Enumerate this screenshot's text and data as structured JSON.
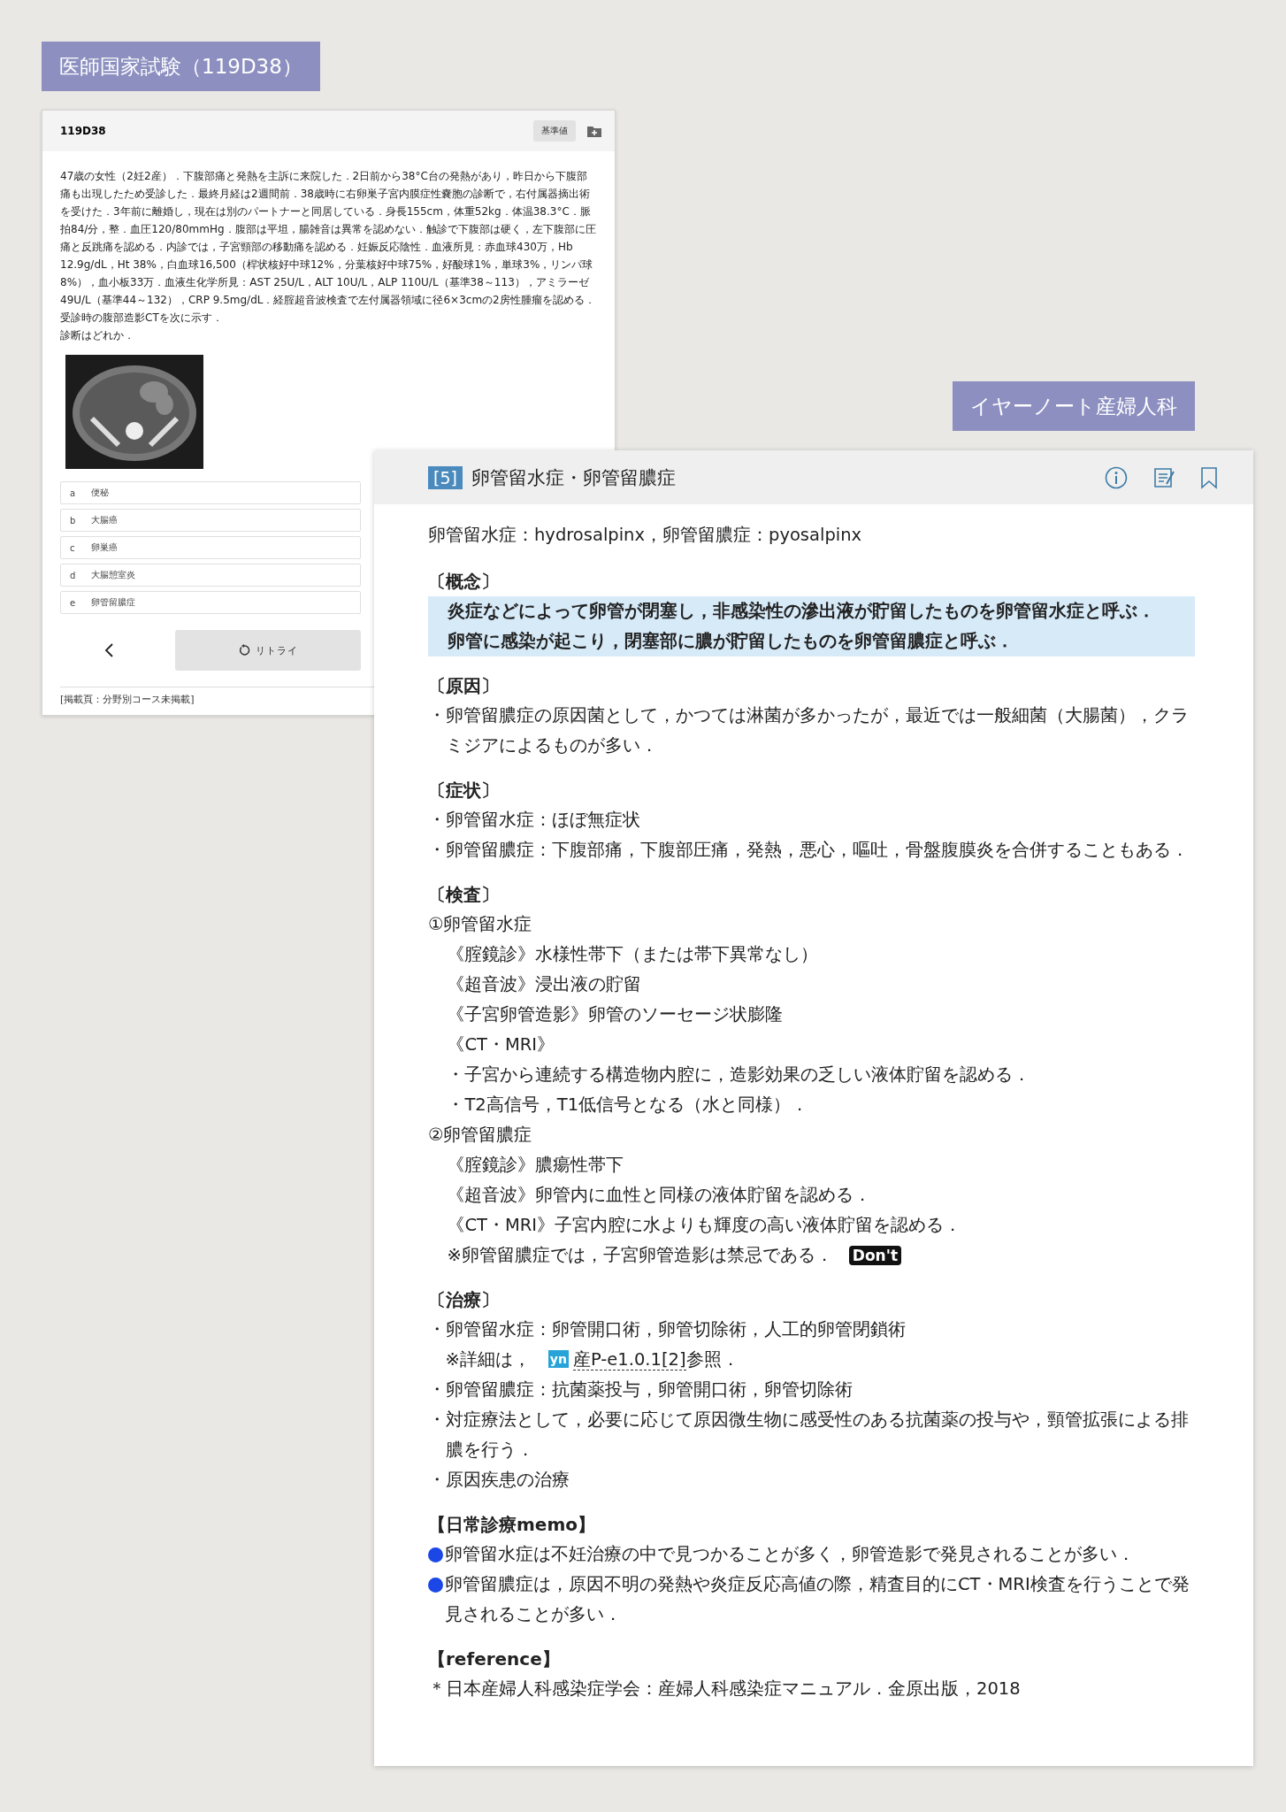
{
  "labels": [
    {
      "text": "医師国家試験（119D38）"
    },
    {
      "text": "イヤーノート産婦人科"
    }
  ],
  "question": {
    "id": "119D38",
    "reference_button": "基準値",
    "text": "47歳の女性（2妊2産）．下腹部痛と発熱を主訴に来院した．2日前から38°C台の発熱があり，昨日から下腹部痛も出現したため受診した．最終月経は2週間前．38歳時に右卵巣子宮内膜症性嚢胞の診断で，右付属器摘出術を受けた．3年前に離婚し，現在は別のパートナーと同居している．身長155cm，体重52kg．体温38.3°C．脈拍84/分，整．血圧120/80mmHg．腹部は平坦，腸雑音は異常を認めない．触診で下腹部は硬く，左下腹部に圧痛と反跳痛を認める．内診では，子宮頸部の移動痛を認める．妊娠反応陰性．血液所見：赤血球430万，Hb 12.9g/dL，Ht 38%，白血球16,500（桿状核好中球12%，分葉核好中球75%，好酸球1%，単球3%，リンパ球8%），血小板33万．血液生化学所見：AST 25U/L，ALT 10U/L，ALP 110U/L（基準38～113），アミラーゼ49U/L（基準44～132），CRP 9.5mg/dL．経腟超音波検査で左付属器領域に径6×3cmの2房性腫瘤を認める．受診時の腹部造影CTを次に示す．",
    "prompt": "診断はどれか．",
    "options": [
      {
        "letter": "a",
        "text": "便秘"
      },
      {
        "letter": "b",
        "text": "大腸癌"
      },
      {
        "letter": "c",
        "text": "卵巣癌"
      },
      {
        "letter": "d",
        "text": "大腸憩室炎"
      },
      {
        "letter": "e",
        "text": "卵管留膿症"
      }
    ],
    "retry_button": "リトライ",
    "footer": "[掲載頁：分野別コース未掲載]"
  },
  "note": {
    "number": "[5]",
    "title": "卵管留水症・卵管留膿症",
    "subtitle": "卵管留水症：hydrosalpinx，卵管留膿症：pyosalpinx",
    "sections": [
      {
        "heading": "〔概念〕",
        "items": [
          {
            "kind": "highlight",
            "lines": [
              "炎症などによって卵管が閉塞し，非感染性の滲出液が貯留したものを卵管留水症と呼ぶ．",
              "卵管に感染が起こり，閉塞部に膿が貯留したものを卵管留膿症と呼ぶ．"
            ]
          }
        ]
      },
      {
        "heading": "〔原因〕",
        "items": [
          {
            "kind": "bullet",
            "text": "・卵管留膿症の原因菌として，かつては淋菌が多かったが，最近では一般細菌（大腸菌），クラミジアによるものが多い．"
          }
        ]
      },
      {
        "heading": "〔症状〕",
        "items": [
          {
            "kind": "bullet",
            "text": "・卵管留水症：ほぼ無症状"
          },
          {
            "kind": "bullet",
            "text": "・卵管留膿症：下腹部痛，下腹部圧痛，発熱，悪心，嘔吐，骨盤腹膜炎を合併することもある．"
          }
        ]
      },
      {
        "heading": "〔検査〕",
        "items": [
          {
            "kind": "plain",
            "text": "①卵管留水症"
          },
          {
            "kind": "indent",
            "text": "《腟鏡診》水様性帯下（または帯下異常なし）"
          },
          {
            "kind": "indent",
            "text": "《超音波》浸出液の貯留"
          },
          {
            "kind": "indent",
            "text": "《子宮卵管造影》卵管のソーセージ状膨隆"
          },
          {
            "kind": "indent",
            "text": "《CT・MRI》"
          },
          {
            "kind": "indent",
            "text": "・子宮から連続する構造物内腔に，造影効果の乏しい液体貯留を認める．"
          },
          {
            "kind": "indent",
            "text": "・T2高信号，T1低信号となる（水と同様）．"
          },
          {
            "kind": "plain",
            "text": "②卵管留膿症"
          },
          {
            "kind": "indent",
            "text": "《腟鏡診》膿瘍性帯下"
          },
          {
            "kind": "indent",
            "text": "《超音波》卵管内に血性と同様の液体貯留を認める．"
          },
          {
            "kind": "indent",
            "text": "《CT・MRI》子宮内腔に水よりも輝度の高い液体貯留を認める．"
          },
          {
            "kind": "indent",
            "text": "※卵管留膿症では，子宮卵管造影は禁忌である．",
            "badge": "Don't"
          }
        ]
      },
      {
        "heading": "〔治療〕",
        "items": [
          {
            "kind": "bullet",
            "text": "・卵管留水症：卵管開口術，卵管切除術，人工的卵管閉鎖術"
          },
          {
            "kind": "ref",
            "text": "※詳細は，",
            "logo": "yn",
            "link": "産P-e1.0.1[2]",
            "after": "参照．"
          },
          {
            "kind": "bullet",
            "text": "・卵管留膿症：抗菌薬投与，卵管開口術，卵管切除術"
          },
          {
            "kind": "bullet",
            "text": "・対症療法として，必要に応じて原因微生物に感受性のある抗菌薬の投与や，頸管拡張による排膿を行う．"
          },
          {
            "kind": "bullet",
            "text": "・原因疾患の治療"
          }
        ]
      },
      {
        "heading": "【日常診療memo】",
        "items": [
          {
            "kind": "dot",
            "text": "卵管留水症は不妊治療の中で見つかることが多く，卵管造影で発見されることが多い．"
          },
          {
            "kind": "dot",
            "text": "卵管留膿症は，原因不明の発熱や炎症反応高値の際，精査目的にCT・MRI検査を行うことで発見されることが多い．"
          }
        ]
      },
      {
        "heading": "【reference】",
        "items": [
          {
            "kind": "plain",
            "text": "＊日本産婦人科感染症学会：産婦人科感染症マニュアル．金原出版，2018"
          }
        ]
      }
    ]
  }
}
